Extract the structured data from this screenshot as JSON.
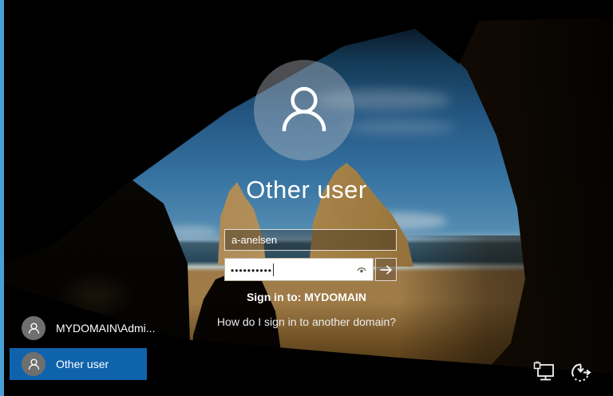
{
  "login": {
    "title": "Other user",
    "username": {
      "value": "a-anelsen"
    },
    "password": {
      "masked_value": "••••••••••"
    },
    "sign_in_to": "Sign in to: MYDOMAIN",
    "help_link": "How do I sign in to another domain?"
  },
  "user_list": {
    "items": [
      {
        "label": "MYDOMAIN\\Admi...",
        "selected": false
      },
      {
        "label": "Other user",
        "selected": true
      }
    ]
  },
  "tray": {
    "network_icon": "wired-network-icon",
    "power_icon": "update-restart-icon",
    "reveal_icon": "reveal-password-eye-icon",
    "submit_icon": "arrow-right-icon"
  },
  "colors": {
    "selection_blue": "#0f63ac",
    "edge_strip_blue": "#4aa0d6",
    "avatar_gray": "#6f6f6f",
    "password_field_bg": "#ffffff"
  }
}
